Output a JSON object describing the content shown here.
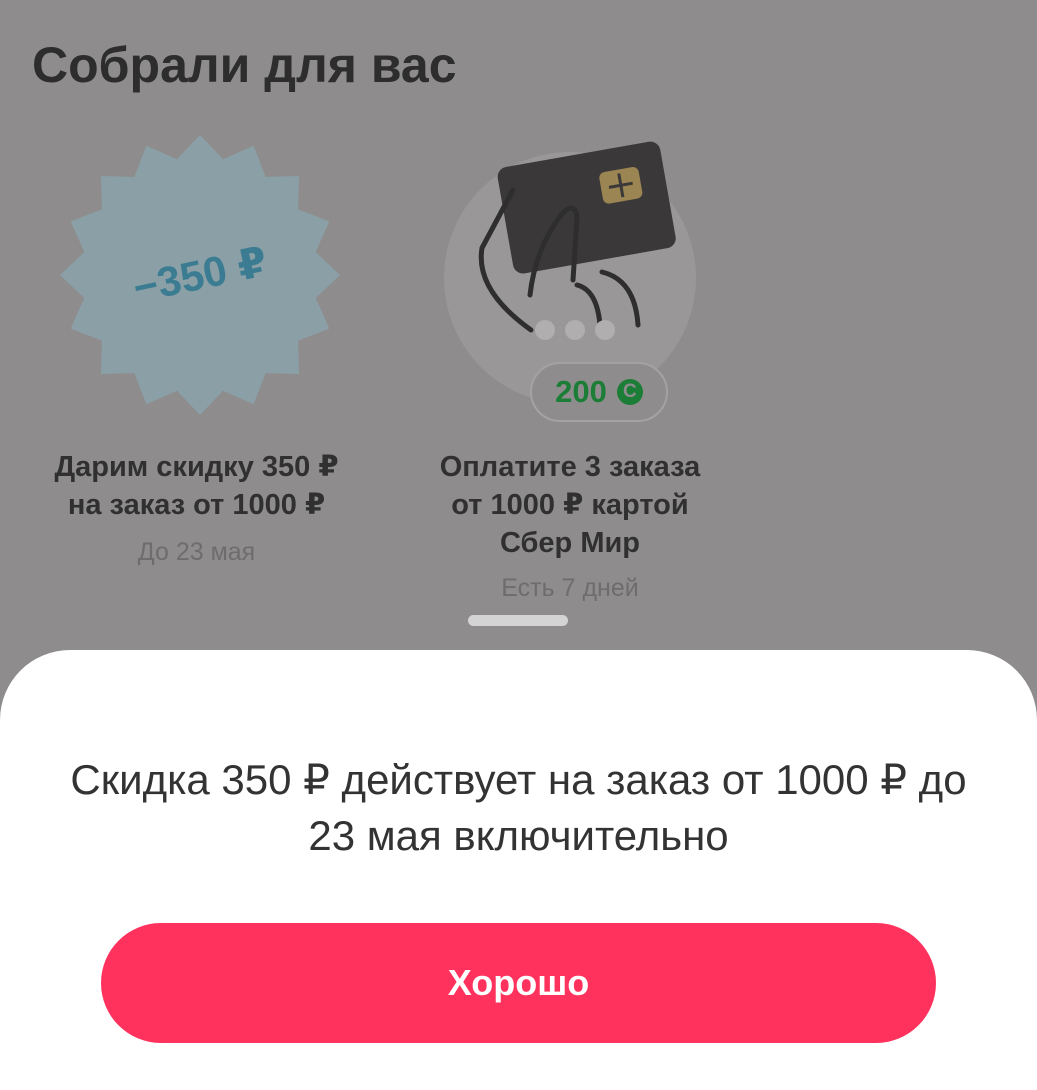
{
  "section": {
    "title": "Собрали для вас"
  },
  "cards": [
    {
      "badge_text": "−350 ₽",
      "title_line1": "Дарим скидку 350 ₽",
      "title_line2": "на заказ от 1000 ₽",
      "subtitle": "До 23 мая"
    },
    {
      "points_value": "200",
      "points_icon": "sber-spasibo-icon",
      "title_line1": "Оплатите 3 заказа",
      "title_line2": "от 1000 ₽ картой",
      "title_line3": "Сбер Мир",
      "subtitle": "Есть 7 дней"
    }
  ],
  "sheet": {
    "message": "Скидка 350 ₽ действует на заказ от 1000 ₽ до 23 мая включительно",
    "ok_label": "Хорошо"
  },
  "colors": {
    "overlay": "#8e8c8d",
    "accent": "#ff325e",
    "points_green": "#1b7d36",
    "badge_blue": "#3c7c92"
  }
}
